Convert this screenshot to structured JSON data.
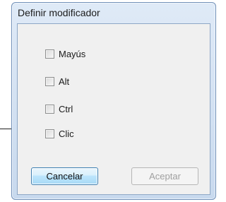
{
  "dialog": {
    "title": "Definir modificador",
    "checkboxes": [
      {
        "label": "Mayús",
        "checked": false
      },
      {
        "label": "Alt",
        "checked": false
      },
      {
        "label": "Ctrl",
        "checked": false
      },
      {
        "label": "Clic",
        "checked": false
      }
    ],
    "buttons": {
      "cancel_label": "Cancelar",
      "accept_label": "Aceptar",
      "accept_enabled": false
    }
  },
  "colors": {
    "frame": "#c8d9ee",
    "client": "#f0f0f0",
    "default_button_border": "#3c7fb1",
    "disabled_text": "#a0a0a0"
  }
}
